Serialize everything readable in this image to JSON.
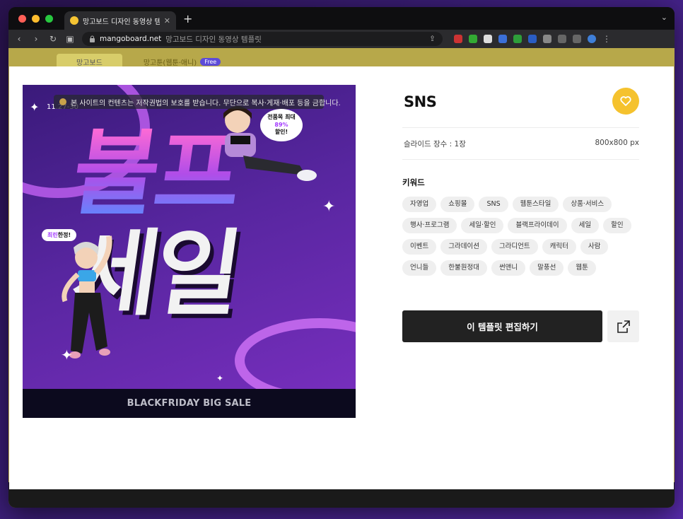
{
  "browser": {
    "tab_title": "망고보드 디자인 동영상 템플릿",
    "url_domain": "mangoboard.net",
    "url_rest": "망고보드 디자인 동영상 템플릿"
  },
  "behind": {
    "tab1": "망고보드",
    "tab2": "망고툰(웹툰·애니)",
    "free": "Free"
  },
  "preview": {
    "copyright_notice": "본 사이트의 컨텐츠는 저작권법의 보호를 받습니다. 무단으로 복사·게재·배포 등을 금합니다.",
    "date": "11.27-30",
    "headline_line1": "블프",
    "headline_line2": "세일",
    "speech_line1": "전품목 최대",
    "speech_accent": "89%",
    "speech_line3": "할인!",
    "speech2_accent": "최린",
    "speech2_text": "한정!",
    "footer": "BLACKFRIDAY BIG SALE"
  },
  "info": {
    "title": "SNS",
    "slides_label": "슬라이드 장수 : 1장",
    "size_label": "800x800 px",
    "keywords_label": "키워드",
    "keywords": [
      "자영업",
      "쇼핑몰",
      "SNS",
      "웹툰스타일",
      "상품·서비스",
      "행사·프로그램",
      "세일·할인",
      "블랙프라이데이",
      "세일",
      "할인",
      "이벤트",
      "그라데이션",
      "그라디언트",
      "캐릭터",
      "사람",
      "언니들",
      "한불원정대",
      "썬앤니",
      "말풍선",
      "웹툰"
    ],
    "edit_button": "이 템플릿 편집하기"
  },
  "colors": {
    "accent_yellow": "#f5c22e",
    "button_dark": "#222222"
  },
  "icons": [
    "heart-icon",
    "external-link-icon",
    "lock-icon",
    "copyright-icon",
    "sparkle-icon"
  ]
}
